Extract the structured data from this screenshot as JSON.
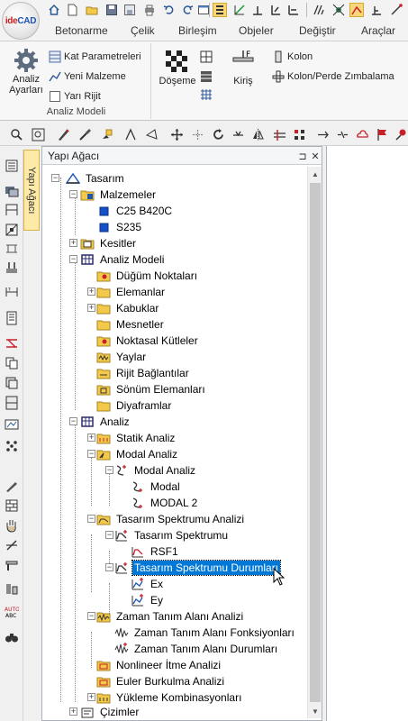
{
  "app": {
    "logo_text": "ideCAD",
    "logo_prefix": "ide",
    "logo_suffix": "CAD"
  },
  "ribbon_tabs": [
    "Betonarme",
    "Çelik",
    "Birleşim",
    "Objeler",
    "Değiştir",
    "Araçlar"
  ],
  "ribbon": {
    "analiz_ayarlari": "Analiz Ayarları",
    "kat_parametreleri": "Kat Parametreleri",
    "yeni_malzeme": "Yeni Malzeme",
    "yari_rijit": "Yarı Rijit",
    "group_label": "Analiz Modeli",
    "doseme": "Döşeme",
    "kiris": "Kiriş",
    "kolon": "Kolon",
    "kolon_perde": "Kolon/Perde Zımbalama"
  },
  "panel": {
    "title": "Yapı Ağacı",
    "side_tab": "Yapı Ağacı",
    "pin": "⊐",
    "close": "✕"
  },
  "tree": [
    {
      "id": "tasarim",
      "label": "Tasarım"
    },
    {
      "id": "malzemeler",
      "label": "Malzemeler"
    },
    {
      "id": "c25",
      "label": "C25 B420C"
    },
    {
      "id": "s235",
      "label": "S235"
    },
    {
      "id": "kesitler",
      "label": "Kesitler"
    },
    {
      "id": "analiz_modeli",
      "label": "Analiz Modeli"
    },
    {
      "id": "dugum",
      "label": "Düğüm Noktaları"
    },
    {
      "id": "elemanlar",
      "label": "Elemanlar"
    },
    {
      "id": "kabuklar",
      "label": "Kabuklar"
    },
    {
      "id": "mesnetler",
      "label": "Mesnetler"
    },
    {
      "id": "noktasal",
      "label": "Noktasal Kütleler"
    },
    {
      "id": "yaylar",
      "label": "Yaylar"
    },
    {
      "id": "rijit",
      "label": "Rijit Bağlantılar"
    },
    {
      "id": "sonum",
      "label": "Sönüm Elemanları"
    },
    {
      "id": "diyafram",
      "label": "Diyaframlar"
    },
    {
      "id": "analiz",
      "label": "Analiz"
    },
    {
      "id": "statik",
      "label": "Statik Analiz"
    },
    {
      "id": "modal_analiz",
      "label": "Modal Analiz"
    },
    {
      "id": "modal_analiz2",
      "label": "Modal Analiz"
    },
    {
      "id": "modal",
      "label": "Modal"
    },
    {
      "id": "modal2",
      "label": "MODAL 2"
    },
    {
      "id": "tsa",
      "label": "Tasarım Spektrumu Analizi"
    },
    {
      "id": "ts",
      "label": "Tasarım Spektrumu"
    },
    {
      "id": "rsf1",
      "label": "RSF1"
    },
    {
      "id": "tsd",
      "label": "Tasarım Spektrumu Durumları"
    },
    {
      "id": "ex",
      "label": "Ex"
    },
    {
      "id": "ey",
      "label": "Ey"
    },
    {
      "id": "zta",
      "label": "Zaman Tanım Alanı Analizi"
    },
    {
      "id": "ztf",
      "label": "Zaman Tanım Alanı Fonksiyonları"
    },
    {
      "id": "ztd",
      "label": "Zaman Tanım Alanı Durumları"
    },
    {
      "id": "nonlineer",
      "label": "Nonlineer İtme Analizi"
    },
    {
      "id": "euler",
      "label": "Euler Burkulma Analizi"
    },
    {
      "id": "yukleme",
      "label": "Yükleme Kombinasyonları"
    },
    {
      "id": "cizimler",
      "label": "Çizimler"
    }
  ]
}
